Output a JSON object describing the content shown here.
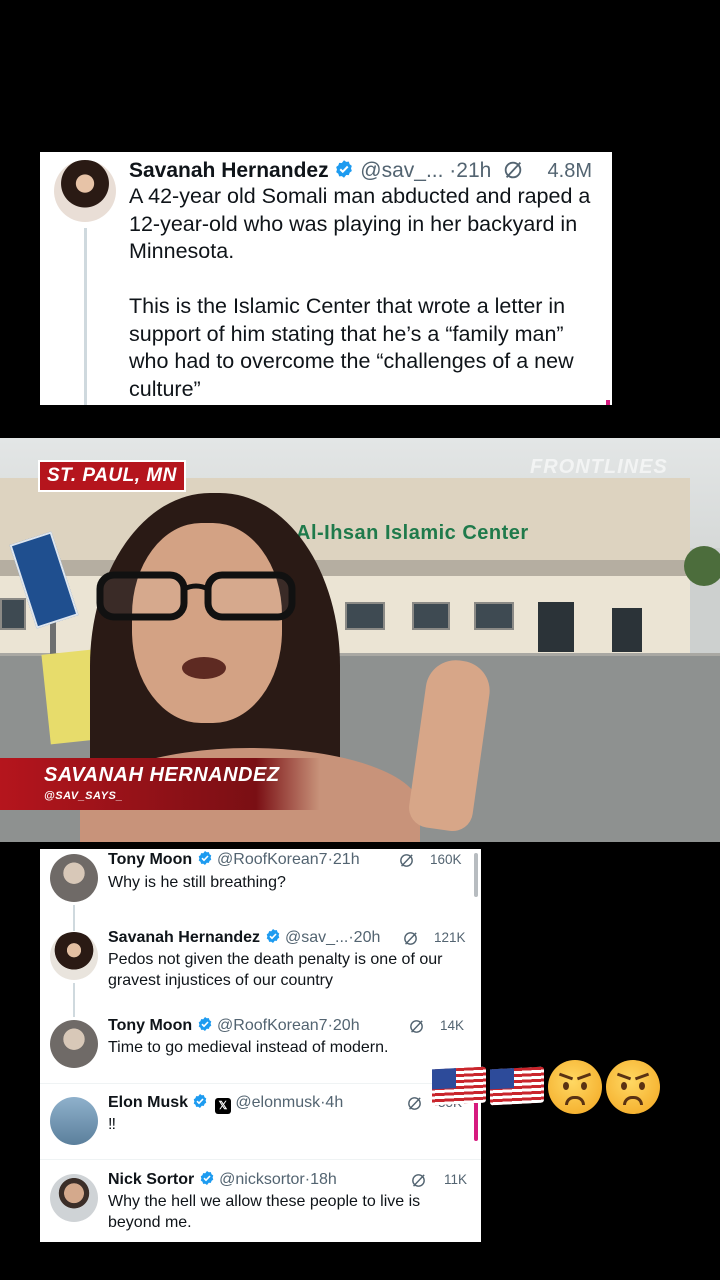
{
  "main_tweet": {
    "author_name": "Savanah Hernandez",
    "handle": "@sav_...",
    "time": "21h",
    "views": "4.8M",
    "body": "A 42-year old Somali man abducted and raped a 12-year-old who was playing in her backyard in Minnesota.\n\nThis is the Islamic Center that wrote a letter in support of him stating that he’s a “family man” who had to overcome the “challenges of a new culture”"
  },
  "video": {
    "location_tag": "ST. PAUL, MN",
    "watermark": "FRONTLINES",
    "building_sign": "Al-Ihsan Islamic Center",
    "lower_third_name": "SAVANAH HERNANDEZ",
    "lower_third_handle": "@SAV_SAYS_"
  },
  "replies": [
    {
      "author_name": "Tony Moon",
      "handle": "@RoofKorean7",
      "time": "21h",
      "views": "160K",
      "text": "Why is he still breathing?"
    },
    {
      "author_name": "Savanah Hernandez",
      "handle": "@sav_...",
      "time": "20h",
      "views": "121K",
      "text": "Pedos not given the death penalty is one of our gravest injustices of our country"
    },
    {
      "author_name": "Tony Moon",
      "handle": "@RoofKorean7",
      "time": "20h",
      "views": "14K",
      "text": "Time to go medieval instead of modern."
    },
    {
      "author_name": "Elon Musk",
      "handle": "@elonmusk",
      "time": "4h",
      "views": "35K",
      "text": "‼",
      "badge": "𝕏"
    },
    {
      "author_name": "Nick Sortor",
      "handle": "@nicksortor",
      "time": "18h",
      "views": "11K",
      "text": "Why the hell we allow these people to live is beyond me."
    }
  ],
  "overlay_emojis": [
    "us-flag",
    "us-flag",
    "angry-face",
    "angry-face"
  ],
  "colors": {
    "verified_blue": "#1d9bf0",
    "text_primary": "#0f1419",
    "text_secondary": "#536471",
    "banner_red": "#b5151d",
    "accent_pink": "#d61a7f"
  }
}
